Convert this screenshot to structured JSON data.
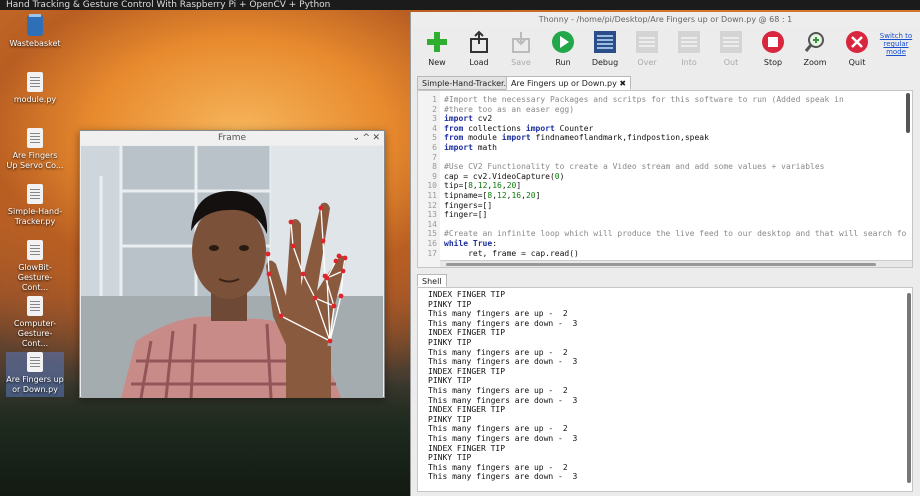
{
  "desktop": {
    "top_strip": "Hand Tracking & Gesture Control With Raspberry Pi + OpenCV + Python",
    "icons": [
      {
        "label": "Wastebasket",
        "type": "trash"
      },
      {
        "label": "module.py",
        "type": "file"
      },
      {
        "label": "Are Fingers Up Servo Co...",
        "type": "file"
      },
      {
        "label": "Simple-Hand-Tracker.py",
        "type": "file"
      },
      {
        "label": "GlowBit-Gesture-Cont...",
        "type": "file"
      },
      {
        "label": "Computer-Gesture-Cont...",
        "type": "file"
      },
      {
        "label": "Are Fingers up or Down.py",
        "type": "file"
      }
    ]
  },
  "frame_window": {
    "title": "Frame",
    "controls": [
      "⌄",
      "^",
      "✕"
    ]
  },
  "thonny": {
    "title": "Thonny  -  /home/pi/Desktop/Are Fingers up or Down.py  @  68 : 1",
    "toolbar": [
      {
        "label": "New",
        "icon": "new-icon",
        "color": "#2fae2f",
        "enabled": true
      },
      {
        "label": "Load",
        "icon": "load-icon",
        "color": "#444444",
        "enabled": true
      },
      {
        "label": "Save",
        "icon": "save-icon",
        "color": "#bbbbbb",
        "enabled": false
      },
      {
        "label": "Run",
        "icon": "run-icon",
        "color": "#22a84a",
        "enabled": true
      },
      {
        "label": "Debug",
        "icon": "debug-icon",
        "color": "#2a4e8a",
        "enabled": true
      },
      {
        "label": "Over",
        "icon": "step-over-icon",
        "color": "#bbbbbb",
        "enabled": false
      },
      {
        "label": "Into",
        "icon": "step-into-icon",
        "color": "#bbbbbb",
        "enabled": false
      },
      {
        "label": "Out",
        "icon": "step-out-icon",
        "color": "#bbbbbb",
        "enabled": false
      },
      {
        "label": "Stop",
        "icon": "stop-icon",
        "color": "#d7263d",
        "enabled": true
      },
      {
        "label": "Zoom",
        "icon": "zoom-icon",
        "color": "#3a8f3a",
        "enabled": true
      },
      {
        "label": "Quit",
        "icon": "quit-icon",
        "color": "#d7263d",
        "enabled": true
      }
    ],
    "switch_mode": "Switch to regular mode",
    "tabs": [
      {
        "label": "Simple-Hand-Tracker.py ✖",
        "active": false
      },
      {
        "label": "Are Fingers up or Down.py ✖",
        "active": true
      }
    ],
    "editor": {
      "line_numbers": [
        "1",
        "2",
        "3",
        "4",
        "5",
        "6",
        "7",
        "8",
        "9",
        "10",
        "11",
        "12",
        "13",
        "14",
        "15",
        "16",
        "17"
      ],
      "lines": [
        "#Import the necessary Packages and scritps for this software to run (Added speak in",
        "#there too as an easer egg)",
        "import cv2",
        "from collections import Counter",
        "from module import findnameoflandmark,findpostion,speak",
        "import math",
        "",
        "#Use CV2 Functionality to create a Video stream and add some values + variables",
        "cap = cv2.VideoCapture(0)",
        "tip=[8,12,16,20]",
        "tipname=[8,12,16,20]",
        "fingers=[]",
        "finger=[]",
        "",
        "#Create an infinite loop which will produce the live feed to our desktop and that will search fo",
        "while True:",
        "     ret, frame = cap.read()"
      ]
    },
    "shell_tab": "Shell",
    "shell_lines": [
      "INDEX FINGER TIP",
      "PINKY TIP",
      "This many fingers are up -  2",
      "This many fingers are down -  3",
      "INDEX FINGER TIP",
      "PINKY TIP",
      "This many fingers are up -  2",
      "This many fingers are down -  3",
      "INDEX FINGER TIP",
      "PINKY TIP",
      "This many fingers are up -  2",
      "This many fingers are down -  3",
      "INDEX FINGER TIP",
      "PINKY TIP",
      "This many fingers are up -  2",
      "This many fingers are down -  3",
      "INDEX FINGER TIP",
      "PINKY TIP",
      "This many fingers are up -  2",
      "This many fingers are down -  3"
    ]
  }
}
